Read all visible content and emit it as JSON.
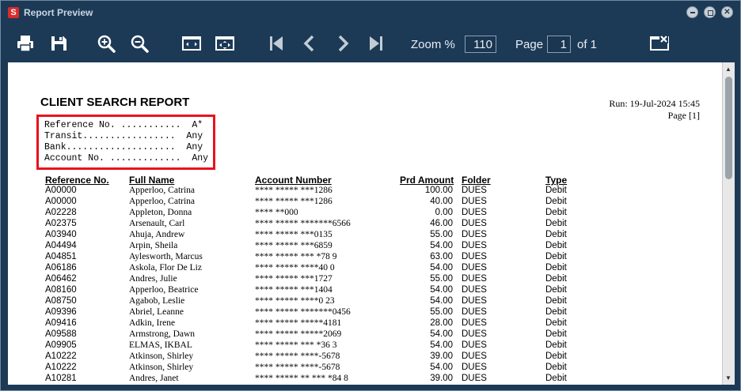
{
  "window": {
    "title": "Report Preview",
    "app_icon": "S"
  },
  "toolbar": {
    "icons": [
      "print-icon",
      "save-icon",
      "zoom-in-icon",
      "zoom-out-icon",
      "fit-width-icon",
      "fit-page-icon",
      "first-page-icon",
      "previous-page-icon",
      "next-page-icon",
      "last-page-icon",
      "close-report-icon"
    ],
    "zoom_label": "Zoom %",
    "zoom_value": "110",
    "page_label": "Page",
    "page_value": "1",
    "of_label": "of 1"
  },
  "report": {
    "title": "CLIENT SEARCH REPORT",
    "run": "Run:  19-Jul-2024 15:45",
    "page": "Page [1]",
    "criteria": [
      "Reference No. ...........  A*",
      "Transit.................  Any",
      "Bank....................  Any",
      "Account No. .............  Any"
    ],
    "columns": [
      "Reference No.",
      "Full Name",
      "Account Number",
      "Prd Amount",
      "Folder",
      "Type"
    ],
    "rows": [
      [
        "A00000",
        "Apperloo, Catrina",
        "**** ***** ***1286",
        "100.00",
        "DUES",
        "Debit"
      ],
      [
        "A00000",
        "Apperloo, Catrina",
        "**** ***** ***1286",
        "40.00",
        "DUES",
        "Debit"
      ],
      [
        "A02228",
        "Appleton, Donna",
        "**** **000",
        "0.00",
        "DUES",
        "Debit"
      ],
      [
        "A02375",
        "Arsenault, Carl",
        "**** ***** *******6566",
        "46.00",
        "DUES",
        "Debit"
      ],
      [
        "A03940",
        "Ahuja, Andrew",
        "**** ***** ***0135",
        "55.00",
        "DUES",
        "Debit"
      ],
      [
        "A04494",
        "Arpin, Sheila",
        "**** ***** ***6859",
        "54.00",
        "DUES",
        "Debit"
      ],
      [
        "A04851",
        "Aylesworth, Marcus",
        "**** ***** *** *78 9",
        "63.00",
        "DUES",
        "Debit"
      ],
      [
        "A06186",
        "Askola, Flor De Liz",
        "**** ***** ****40 0",
        "54.00",
        "DUES",
        "Debit"
      ],
      [
        "A06462",
        "Andres, Julie",
        "**** ***** ***1727",
        "55.00",
        "DUES",
        "Debit"
      ],
      [
        "A08160",
        "Apperloo, Beatrice",
        "**** ***** ***1404",
        "54.00",
        "DUES",
        "Debit"
      ],
      [
        "A08750",
        "Agabob, Leslie",
        "**** ***** ****0 23",
        "54.00",
        "DUES",
        "Debit"
      ],
      [
        "A09396",
        "Abriel, Leanne",
        "**** ***** *******0456",
        "55.00",
        "DUES",
        "Debit"
      ],
      [
        "A09416",
        "Adkin, Irene",
        "**** ***** *****4181",
        "28.00",
        "DUES",
        "Debit"
      ],
      [
        "A09588",
        "Armstrong, Dawn",
        "**** ***** *****2069",
        "54.00",
        "DUES",
        "Debit"
      ],
      [
        "A09905",
        "ELMAS, IKBAL",
        "**** ***** *** *36 3",
        "54.00",
        "DUES",
        "Debit"
      ],
      [
        "A10222",
        "Atkinson, Shirley",
        "**** ***** ****-5678",
        "39.00",
        "DUES",
        "Debit"
      ],
      [
        "A10222",
        "Atkinson, Shirley",
        "**** ***** ****-5678",
        "54.00",
        "DUES",
        "Debit"
      ],
      [
        "A10281",
        "Andres, Janet",
        "**** ***** ** *** *84 8",
        "39.00",
        "DUES",
        "Debit"
      ]
    ]
  },
  "scrollbar": {
    "position": 0.0
  }
}
